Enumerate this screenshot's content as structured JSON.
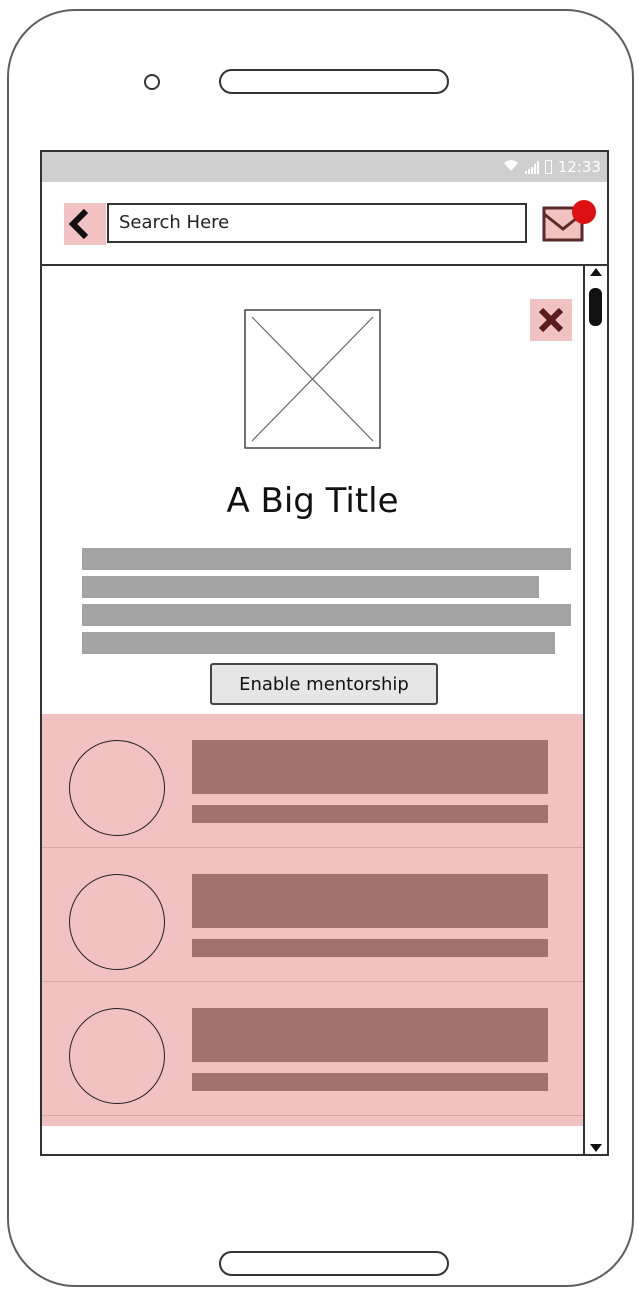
{
  "status_bar": {
    "time": "12:33",
    "icons": [
      "wifi-icon",
      "signal-icon",
      "battery-icon"
    ]
  },
  "app_bar": {
    "back_icon": "chevron-left-icon",
    "search_text": "Search Here",
    "mail_icon": "mail-icon",
    "has_notification": true
  },
  "card": {
    "close_icon": "close-icon",
    "image_icon": "image-placeholder",
    "title": "A Big Title",
    "button_label": "Enable mentorship"
  },
  "list": {
    "item_count": 3
  },
  "colors": {
    "highlight": "#f2c1c1",
    "placeholder_bar": "#a27270",
    "text_bar": "#a3a3a3",
    "notification": "#dd1111",
    "status_bar": "#cfcfcf"
  }
}
